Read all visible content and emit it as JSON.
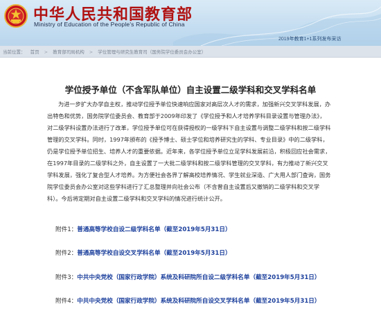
{
  "header": {
    "title": "中华人民共和国教育部",
    "subtitle": "Ministry of Education of the People's Republic of China",
    "feature_link": "2019年教育1+1系列发布采访"
  },
  "breadcrumb": [
    "当前位置：",
    "首页",
    ">",
    "教育部司局机构",
    ">",
    "学位管理与研究生教育司（国务院学位委员会办公室）"
  ],
  "article": {
    "title": "学位授予单位（不含军队单位）自主设置二级学科和交叉学科名单",
    "lines": [
      "为进一步扩大办学自主权，推动学位授予单位快速响应国家对高层次人才的需求，加强新兴交叉学科发展，办",
      "出特色和优势，国务院学位委员会、教育部于2009年印发了《学位授予和人才培养学科目录设置与管理办法》，",
      "对二级学科设置办法进行了改革，学位授予单位可在获得授权的一级学科下自主设置与调整二级学科和按二级学科",
      "管理的交叉学科。同时，1997年颁布的《授予博士、硕士学位和培养研究生的学科、专业目录》中的二级学科，",
      "仍是学位授予单位招生、培养人才的重要依据。近年来，各学位授予单位立足学科发展前沿，积极回应社会需求，",
      "在1997年目录的二级学科之外，自主设置了一大批二级学科和按二级学科管理的交叉学科，有力推动了新兴交叉",
      "学科发展，强化了复合型人才培养。为方便社会各界了解高校培养情况、学生就业深造、广大用人部门查询，国务",
      "院学位委员会办公室对这些学科进行了汇总整理并向社会公布（不含曾自主设置后又撤销的二级学科和交叉学",
      "科）。今后将定期对自主设置二级学科和交叉学科的情况进行统计公开。"
    ],
    "attachments": [
      {
        "label": "附件1：",
        "link": "普通高等学校自设二级学科名单（截至2019年5月31日）"
      },
      {
        "label": "附件2：",
        "link": "普通高等学校自设交叉学科名单（截至2019年5月31日）"
      },
      {
        "label": "附件3：",
        "link": "中共中央党校（国家行政学院）系统及科研院所自设二级学科名单（截至2019年5月31日）"
      },
      {
        "label": "附件4：",
        "link": "中共中央党校（国家行政学院）系统及科研院所自设交叉学科名单（截至2019年5月31日）"
      }
    ]
  },
  "colors": {
    "title_red": "#b01212",
    "link_blue": "#1b3f9c",
    "header_blue": "#c6def1"
  },
  "icons": [
    "national-emblem-icon"
  ]
}
